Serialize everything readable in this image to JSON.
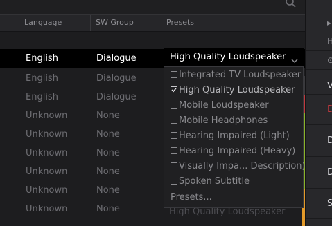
{
  "columns": {
    "language": "Language",
    "sw_group": "SW Group",
    "presets": "Presets"
  },
  "rows": [
    {
      "language": "English",
      "sw_group": "Dialogue",
      "preset": "High Quality Loudspeaker"
    },
    {
      "language": "English",
      "sw_group": "Dialogue"
    },
    {
      "language": "English",
      "sw_group": "Dialogue"
    },
    {
      "language": "Unknown",
      "sw_group": "None"
    },
    {
      "language": "Unknown",
      "sw_group": "None"
    },
    {
      "language": "Unknown",
      "sw_group": "None"
    },
    {
      "language": "Unknown",
      "sw_group": "None"
    },
    {
      "language": "Unknown",
      "sw_group": "None"
    },
    {
      "language": "Unknown",
      "sw_group": "None",
      "preset": "High Quality Loudspeaker"
    }
  ],
  "preset_dropdown": {
    "selected": "High Quality Loudspeaker",
    "options": [
      {
        "label": "Integrated TV Loudspeaker",
        "checked": false
      },
      {
        "label": "High Quality Loudspeaker",
        "checked": true
      },
      {
        "label": "Mobile Loudspeaker",
        "checked": false
      },
      {
        "label": "Mobile Headphones",
        "checked": false
      },
      {
        "label": "Hearing Impaired (Light)",
        "checked": false
      },
      {
        "label": "Hearing Impaired (Heavy)",
        "checked": false
      },
      {
        "label": "Visually Impa... Description)",
        "checked": false
      },
      {
        "label": "Spoken Subtitle",
        "checked": false
      }
    ],
    "footer": "Presets..."
  },
  "right_panel": {
    "glyphs": [
      "▸",
      "H",
      "⊙"
    ],
    "labels": [
      "V",
      "D",
      "D",
      "D",
      "S"
    ]
  },
  "colors": {
    "accent_green": "#8ab32a",
    "accent_red": "#c0393e",
    "accent_orange": "#e39a2a"
  }
}
